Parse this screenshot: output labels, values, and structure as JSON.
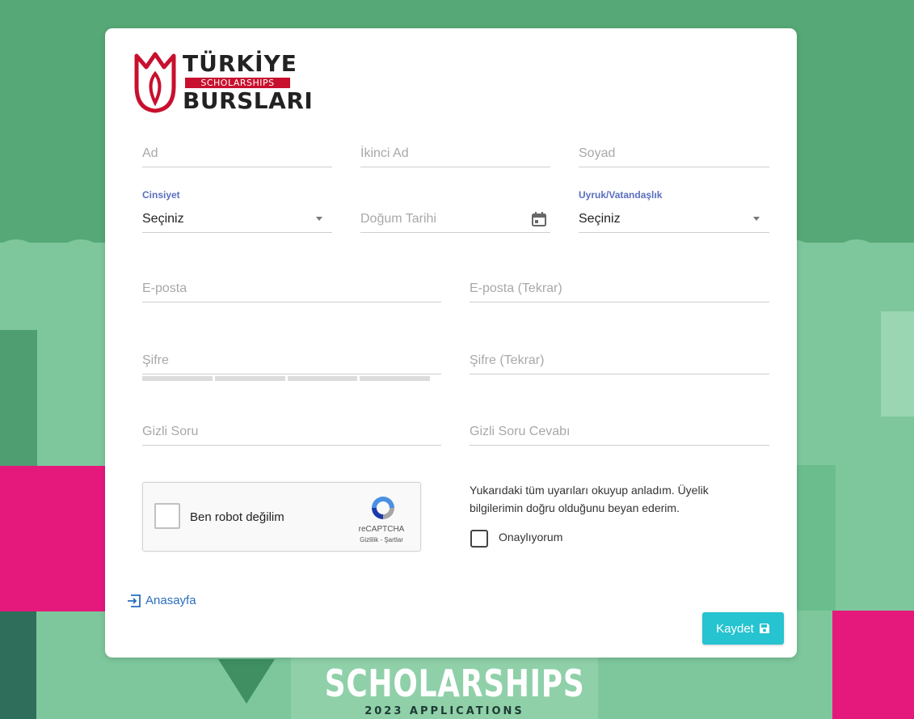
{
  "logo": {
    "line1": "TÜRKİYE",
    "line2": "SCHOLARSHIPS",
    "line3": "BURSLARI"
  },
  "form": {
    "first_name": {
      "placeholder": "Ad"
    },
    "middle_name": {
      "placeholder": "İkinci Ad"
    },
    "last_name": {
      "placeholder": "Soyad"
    },
    "gender": {
      "label": "Cinsiyet",
      "value": "Seçiniz"
    },
    "birth_date": {
      "placeholder": "Doğum Tarihi"
    },
    "nationality": {
      "label": "Uyruk/Vatandaşlık",
      "value": "Seçiniz"
    },
    "email": {
      "placeholder": "E-posta"
    },
    "email_confirm": {
      "placeholder": "E-posta (Tekrar)"
    },
    "password": {
      "placeholder": "Şifre"
    },
    "password_confirm": {
      "placeholder": "Şifre (Tekrar)"
    },
    "secret_question": {
      "placeholder": "Gizli Soru"
    },
    "secret_answer": {
      "placeholder": "Gizli Soru Cevabı"
    }
  },
  "captcha": {
    "label": "Ben robot değilim",
    "brand": "reCAPTCHA",
    "links": "Gizlilik - Şartlar"
  },
  "notice": "Yukarıdaki tüm uyarıları okuyup anladım. Üyelik bilgilerimin doğru olduğunu beyan ederim.",
  "consent_label": "Onaylıyorum",
  "home_link": "Anasayfa",
  "save_button": "Kaydet",
  "background": {
    "poster_title": "SCHOLARSHIPS",
    "poster_subtitle": "2023 APPLICATIONS"
  },
  "colors": {
    "accent_button": "#26c3d0",
    "link": "#2a6ebd",
    "label": "#5a6fc0",
    "brand_red": "#c8102e",
    "background_green": "#5aab7d"
  },
  "icons": [
    "calendar-icon",
    "login-arrow-icon",
    "save-icon",
    "recaptcha-icon",
    "tulip-logo-icon"
  ]
}
